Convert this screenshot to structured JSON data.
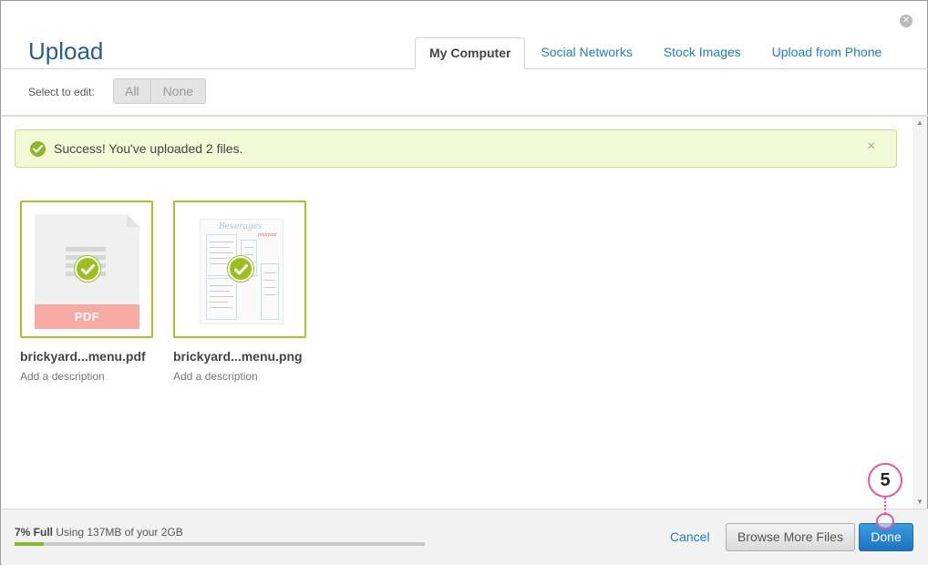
{
  "dialog": {
    "title": "Upload",
    "close_icon": "close-icon"
  },
  "tabs": [
    {
      "label": "My Computer",
      "active": true
    },
    {
      "label": "Social Networks",
      "active": false
    },
    {
      "label": "Stock Images",
      "active": false
    },
    {
      "label": "Upload from Phone",
      "active": false
    }
  ],
  "select": {
    "label": "Select to edit:",
    "all": "All",
    "none": "None"
  },
  "alert": {
    "message": "Success! You've uploaded 2 files.",
    "close": "×",
    "icon": "check-circle-icon"
  },
  "files": [
    {
      "name": "brickyard...menu.pdf",
      "description": "Add a description",
      "type_label": "PDF",
      "selected": true
    },
    {
      "name": "brickyard...menu.png",
      "description": "Add a description",
      "preview_title": "Beverages",
      "preview_logo": "brickyard",
      "selected": true
    }
  ],
  "footer": {
    "usage_percent_label": "7% Full",
    "usage_detail": "Using 137MB of your 2GB",
    "usage_fraction": 0.07,
    "cancel": "Cancel",
    "browse": "Browse More Files",
    "done": "Done"
  },
  "callout": {
    "step": "5"
  },
  "colors": {
    "accent": "#1f7fc1",
    "success": "#8db62a",
    "callout": "#e8559a",
    "pdf_band": "#f7a9a3"
  }
}
